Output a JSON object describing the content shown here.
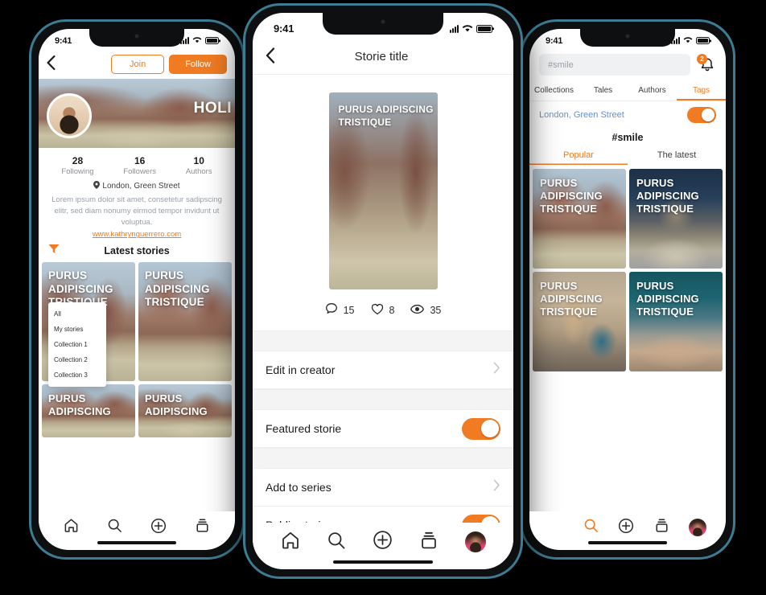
{
  "theme": {
    "accent": "#F07B23",
    "frame_edge": "#3d7c92",
    "background": "#000000",
    "link_blue": "#6b8ec9"
  },
  "left_phone": {
    "status": {
      "time": "9:41",
      "signal_icon": "cellular-signal-icon",
      "wifi_icon": "wifi-icon",
      "battery_icon": "battery-icon"
    },
    "header": {
      "back_icon": "chevron-left-icon",
      "join_label": "Join",
      "follow_label": "Follow"
    },
    "hero": {
      "word": "HOLI",
      "avatar": "profile-avatar"
    },
    "stats": [
      {
        "num": "28",
        "label": "Following"
      },
      {
        "num": "16",
        "label": "Followers"
      },
      {
        "num": "10",
        "label": "Authors"
      }
    ],
    "location": {
      "pin_icon": "location-pin-icon",
      "text": "London, Green Street"
    },
    "bio": "Lorem ipsum dolor sit amet, consetetur sadipscing elitr, sed diam nonumy eirmod tempor invidunt ut voluptua.",
    "website": "www.kathrynguerrero.com",
    "section": {
      "filter_icon": "filter-icon",
      "title": "Latest stories"
    },
    "dropdown": [
      "All",
      "My stories",
      "Collection 1",
      "Collection 2",
      "Collection 3"
    ],
    "cards": [
      {
        "title": "PURUS ADIPISCING TRISTIQUE",
        "photo": "ph-canyon"
      },
      {
        "title": "PURUS ADIPISCING TRISTIQUE",
        "photo": "ph-canyon2"
      },
      {
        "title": "PURUS ADIPISCING",
        "photo": "ph-canyon2"
      },
      {
        "title": "PURUS ADIPISCING",
        "photo": "ph-canyon"
      }
    ],
    "nav": [
      "home-icon",
      "search-icon",
      "plus-circle-icon",
      "stack-icon"
    ]
  },
  "center_phone": {
    "status": {
      "time": "9:41",
      "signal_icon": "cellular-signal-icon",
      "wifi_icon": "wifi-icon",
      "battery_icon": "battery-icon"
    },
    "header": {
      "back_icon": "chevron-left-icon",
      "title": "Storie title"
    },
    "story": {
      "title": "PURUS ADIPISCING TRISTIQUE",
      "photo": "ph-hero"
    },
    "stats": [
      {
        "icon": "comment-icon",
        "value": "15"
      },
      {
        "icon": "heart-icon",
        "value": "8"
      },
      {
        "icon": "eye-icon",
        "value": "35"
      }
    ],
    "settings": [
      {
        "label": "Edit in creator",
        "control": "chevron",
        "value": ""
      },
      {
        "label": "Featured storie",
        "control": "toggle",
        "value": "on"
      },
      {
        "label": "Add to series",
        "control": "chevron",
        "value": ""
      },
      {
        "label": "Public storie",
        "control": "toggle",
        "value": "on"
      }
    ],
    "nav": [
      "home-icon",
      "search-icon",
      "plus-circle-icon",
      "stack-icon",
      "avatar-icon"
    ]
  },
  "right_phone": {
    "status": {
      "time": "9:41",
      "signal_icon": "cellular-signal-icon",
      "wifi_icon": "wifi-icon",
      "battery_icon": "battery-icon"
    },
    "search": {
      "placeholder": "#smile",
      "value": "#smile",
      "icon": "search-icon"
    },
    "bell": {
      "icon": "bell-icon",
      "badge": "2"
    },
    "tabs": [
      {
        "label": "Collections",
        "active": false
      },
      {
        "label": "Tales",
        "active": false
      },
      {
        "label": "Authors",
        "active": false
      },
      {
        "label": "Tags",
        "active": true
      }
    ],
    "location": {
      "text": "London, Green Street",
      "toggle": "on"
    },
    "hashtag": "#smile",
    "subtabs": [
      {
        "label": "Popular",
        "active": true
      },
      {
        "label": "The latest",
        "active": false
      }
    ],
    "cards": [
      {
        "title": "PURUS ADIPISCING TRISTIQUE",
        "photo": "ph-canyon2"
      },
      {
        "title": "PURUS ADIPISCING TRISTIQUE",
        "photo": "ph-temple"
      },
      {
        "title": "PURUS ADIPISCING TRISTIQUE",
        "photo": "ph-window"
      },
      {
        "title": "PURUS ADIPISCING TRISTIQUE",
        "photo": "ph-venice"
      }
    ],
    "nav": [
      "search-icon",
      "plus-circle-icon",
      "stack-icon",
      "avatar-icon"
    ]
  }
}
